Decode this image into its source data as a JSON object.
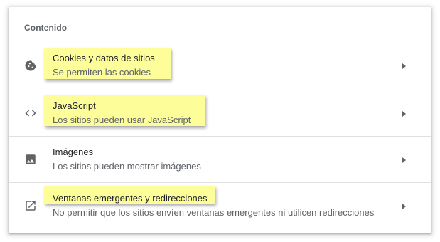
{
  "section": {
    "title": "Contenido"
  },
  "rows": [
    {
      "icon": "cookie-icon",
      "title": "Cookies y datos de sitios",
      "subtitle": "Se permiten las cookies"
    },
    {
      "icon": "code-icon",
      "title": "JavaScript",
      "subtitle": "Los sitios pueden usar JavaScript"
    },
    {
      "icon": "image-icon",
      "title": "Imágenes",
      "subtitle": "Los sitios pueden mostrar imágenes"
    },
    {
      "icon": "open-in-new-icon",
      "title": "Ventanas emergentes y redirecciones",
      "subtitle": "No permitir que los sitios envíen ventanas emergentes ni utilicen redirecciones"
    }
  ],
  "colors": {
    "highlight": "#fdfd9a",
    "icon": "#5f6368",
    "title_text": "#202124",
    "subtitle_text": "#5f6368",
    "divider": "#e0e0e0"
  }
}
